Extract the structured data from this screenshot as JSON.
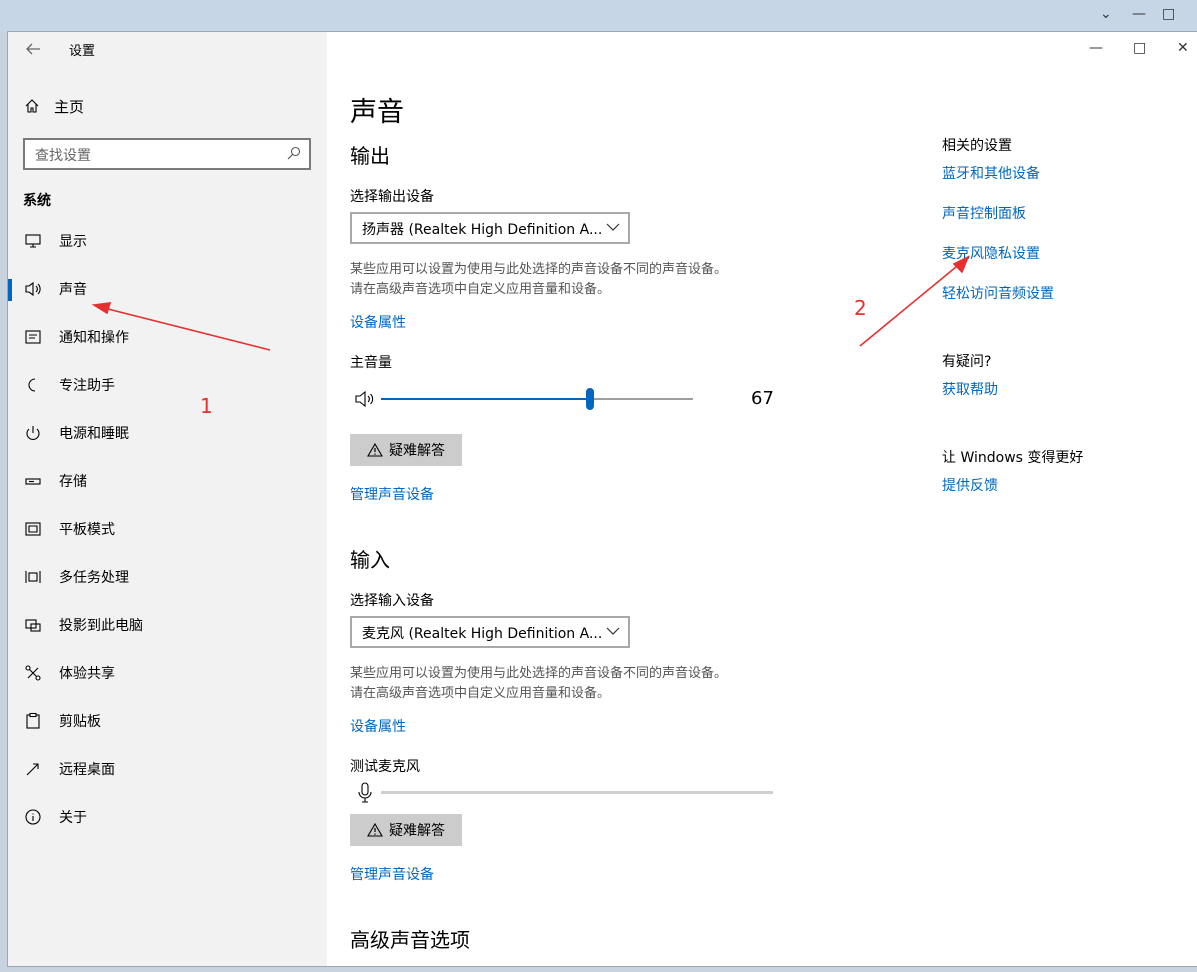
{
  "app": {
    "title": "设置"
  },
  "sidebar": {
    "home": "主页",
    "search_placeholder": "查找设置",
    "section": "系统",
    "items": [
      {
        "label": "显示",
        "icon": "monitor-icon"
      },
      {
        "label": "声音",
        "icon": "speaker-icon",
        "active": true
      },
      {
        "label": "通知和操作",
        "icon": "notification-icon"
      },
      {
        "label": "专注助手",
        "icon": "moon-icon"
      },
      {
        "label": "电源和睡眠",
        "icon": "power-icon"
      },
      {
        "label": "存储",
        "icon": "storage-icon"
      },
      {
        "label": "平板模式",
        "icon": "tablet-icon"
      },
      {
        "label": "多任务处理",
        "icon": "multitask-icon"
      },
      {
        "label": "投影到此电脑",
        "icon": "project-icon"
      },
      {
        "label": "体验共享",
        "icon": "share-icon"
      },
      {
        "label": "剪贴板",
        "icon": "clipboard-icon"
      },
      {
        "label": "远程桌面",
        "icon": "remote-desktop-icon"
      },
      {
        "label": "关于",
        "icon": "info-icon"
      }
    ]
  },
  "main": {
    "title": "声音",
    "output": {
      "heading": "输出",
      "select_label": "选择输出设备",
      "device": "扬声器 (Realtek High Definition A...",
      "desc_line1": "某些应用可以设置为使用与此处选择的声音设备不同的声音设备。",
      "desc_line2": "请在高级声音选项中自定义应用音量和设备。",
      "properties_link": "设备属性",
      "volume_label": "主音量",
      "volume": 67,
      "volume_text": "67",
      "troubleshoot": "疑难解答",
      "manage_link": "管理声音设备"
    },
    "input": {
      "heading": "输入",
      "select_label": "选择输入设备",
      "device": "麦克风 (Realtek High Definition A...",
      "desc_line1": "某些应用可以设置为使用与此处选择的声音设备不同的声音设备。",
      "desc_line2": "请在高级声音选项中自定义应用音量和设备。",
      "properties_link": "设备属性",
      "test_label": "测试麦克风",
      "troubleshoot": "疑难解答",
      "manage_link": "管理声音设备"
    },
    "advanced_heading": "高级声音选项"
  },
  "related": {
    "heading": "相关的设置",
    "links": [
      "蓝牙和其他设备",
      "声音控制面板",
      "麦克风隐私设置",
      "轻松访问音频设置"
    ],
    "question_heading": "有疑问?",
    "help_link": "获取帮助",
    "feedback_heading": "让 Windows 变得更好",
    "feedback_link": "提供反馈"
  },
  "annotations": {
    "label1": "1",
    "label2": "2",
    "color": "#e5302f"
  },
  "colors": {
    "accent": "#0067c0",
    "sidebar_bg": "#f2f2f2"
  }
}
